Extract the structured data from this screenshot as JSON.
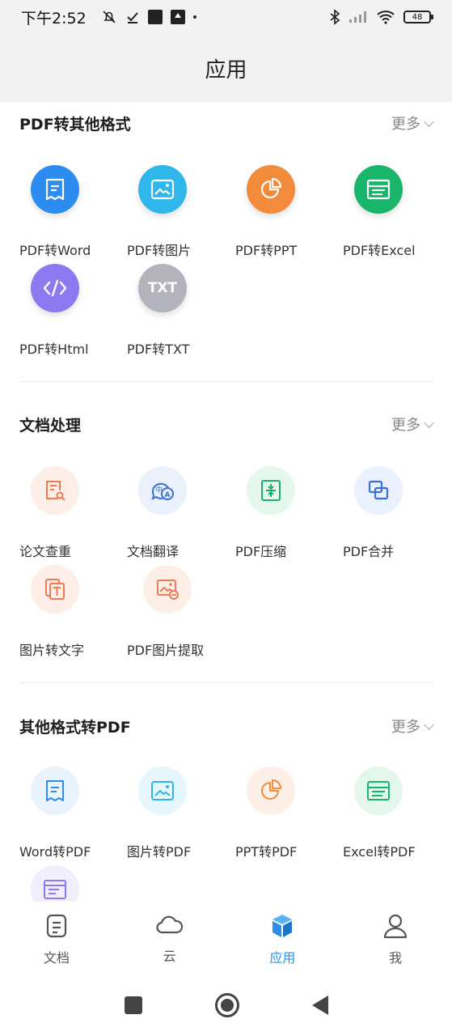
{
  "status_bar": {
    "time": "下午2:52",
    "battery": "48"
  },
  "header": {
    "title": "应用"
  },
  "sections": [
    {
      "title": "PDF转其他格式",
      "more": "更多",
      "items": [
        {
          "label": "PDF转Word",
          "icon": "word-doc-icon",
          "color": "#2d8cf0"
        },
        {
          "label": "PDF转图片",
          "icon": "image-icon",
          "color": "#2fb6ea"
        },
        {
          "label": "PDF转PPT",
          "icon": "pie-chart-icon",
          "color": "#f28b3c"
        },
        {
          "label": "PDF转Excel",
          "icon": "spreadsheet-icon",
          "color": "#19b56a"
        },
        {
          "label": "PDF转Html",
          "icon": "code-icon",
          "color": "#8e7af0"
        },
        {
          "label": "PDF转TXT",
          "icon": "txt-icon",
          "color": "#b3b3bd",
          "icon_text": "TXT"
        }
      ]
    },
    {
      "title": "文档处理",
      "more": "更多",
      "items": [
        {
          "label": "论文查重",
          "icon": "paper-check-icon",
          "color": "#f07a56"
        },
        {
          "label": "文档翻译",
          "icon": "translate-icon",
          "color": "#3b6fd0"
        },
        {
          "label": "PDF压缩",
          "icon": "compress-icon",
          "color": "#1fae6a"
        },
        {
          "label": "PDF合并",
          "icon": "merge-icon",
          "color": "#3b6fd0"
        },
        {
          "label": "图片转文字",
          "icon": "image-to-text-icon",
          "color": "#f07a56"
        },
        {
          "label": "PDF图片提取",
          "icon": "image-extract-icon",
          "color": "#f07a56"
        }
      ]
    },
    {
      "title": "其他格式转PDF",
      "more": "更多",
      "items": [
        {
          "label": "Word转PDF",
          "icon": "word-doc-icon",
          "color": "#2d8cf0"
        },
        {
          "label": "图片转PDF",
          "icon": "image-icon",
          "color": "#2fb6ea"
        },
        {
          "label": "PPT转PDF",
          "icon": "pie-chart-icon",
          "color": "#f28b3c"
        },
        {
          "label": "Excel转PDF",
          "icon": "spreadsheet-icon",
          "color": "#19b56a"
        },
        {
          "label": "",
          "icon": "html-window-icon",
          "color": "#8e7af0"
        }
      ]
    }
  ],
  "bottom_nav": [
    {
      "label": "文档",
      "icon": "document-icon",
      "active": false
    },
    {
      "label": "云",
      "icon": "cloud-icon",
      "active": false
    },
    {
      "label": "应用",
      "icon": "cube-icon",
      "active": true
    },
    {
      "label": "我",
      "icon": "user-icon",
      "active": false
    }
  ],
  "colors": {
    "accent": "#2a8ee6",
    "header_bg": "#f2f2f2"
  }
}
